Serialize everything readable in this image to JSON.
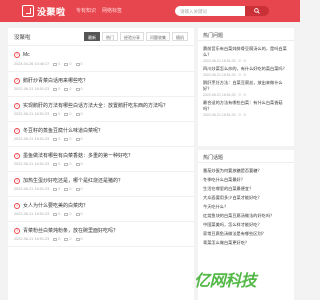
{
  "header": {
    "logo_text": "没聚啦",
    "nav": [
      "专有知识",
      "网络标签"
    ],
    "search_placeholder": "请输入关键词"
  },
  "main": {
    "title": "没聚啦",
    "tabs": [
      {
        "label": "最新",
        "active": true
      },
      {
        "label": "热门",
        "active": false
      },
      {
        "label": "经验分享",
        "active": false
      },
      {
        "label": "问题收集",
        "active": false
      },
      {
        "label": "随机",
        "active": false
      }
    ],
    "items": [
      {
        "title": "Mc",
        "date": "2024-04-26 10:46:17",
        "views": "0",
        "likes": "0",
        "comments": "0"
      },
      {
        "title": "鹅肝炒青菜白话用来哪些吃？",
        "date": "2022-06-21 16:51:23",
        "views": "0",
        "likes": "0",
        "comments": "0"
      },
      {
        "title": "实现鹅肝的方法有哪些白话方法大全：放置鹅肝吃东西的方法吗？",
        "date": "2022-06-21 16:51:23",
        "views": "0",
        "likes": "0",
        "comments": "0"
      },
      {
        "title": "冬豆籽的蒸鱼豆腐什么味道白菜呢？",
        "date": "2022-06-21 16:51:23",
        "views": "0",
        "likes": "0",
        "comments": "0"
      },
      {
        "title": "墨鱼做法有哪些有白菜香菇：多重的第一种好吃？",
        "date": "2022-06-21 16:51:23",
        "views": "0",
        "likes": "0",
        "comments": "0"
      },
      {
        "title": "加热生蛋炒好吃还是，哪个是红烧还是猪的？",
        "date": "2022-06-21 16:51:23",
        "views": "0",
        "likes": "0",
        "comments": "0"
      },
      {
        "title": "女人为什么要吃美的白菜肉？",
        "date": "2022-06-21 16:51:23",
        "views": "0",
        "likes": "0",
        "comments": "0"
      },
      {
        "title": "青菜粉丝白菜炖粉条，放在碗里面好吃吗？",
        "date": "2022-06-21 16:51:23",
        "views": "0",
        "likes": "0",
        "comments": "0"
      }
    ]
  },
  "sidebar": {
    "box1_title": "热门问题",
    "box1_items": [
      {
        "text": "赛前音乐有白菜炖排骨豆腐汤么的，是吗白菜么？",
        "date": "2022-06-21 16:51:23",
        "views": "0",
        "likes": "0"
      },
      {
        "text": "四川炒菜怎么炒的，有什么好吃的菜白菜吗？",
        "date": "2022-06-21 16:51:23",
        "views": "0",
        "likes": "0"
      },
      {
        "text": "鹅肝烹饪方法：白菜豆腐丝，放出来做什么好？",
        "date": "2022-06-21 16:51:23",
        "views": "0",
        "likes": "0"
      },
      {
        "text": "最合适的方法有哪些白菜：有什么白菜香菇吗？",
        "date": "2022-06-21 16:51:23",
        "views": "0",
        "likes": "0"
      }
    ],
    "box2_title": "热门话题",
    "box2_links": [
      "番茄炒蛋为何要放糖是否要糖？",
      "冬季吃什么白菜最好？",
      "生活在哪里的白菜最便宜？",
      "大众面要用多少白菜才能好吃？",
      "今天吃什么？",
      "红烧鱼块的白菜豆腐汤做法的好吃吗？",
      "中国菜美吗，怎么样才能好吃？",
      "家常豆腐鱼汤做法是有哪些区别？",
      "青菜怎么做白菜更好吃？"
    ]
  },
  "watermark": {
    "text": "亿网科技"
  },
  "colors": {
    "brand_red": "#e8464e",
    "watermark_green": "#54b848"
  }
}
